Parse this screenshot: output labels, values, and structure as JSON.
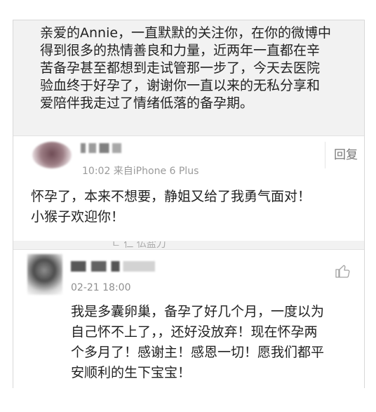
{
  "post": {
    "lines": [
      "亲爱的Annie，一直默默的关注你，在你的微博中",
      "得到很多的热情善良和力量，近两年一直都在辛",
      "苦备孕甚至都想到走试管那一步了，今天去医院",
      "验血终于好孕了，谢谢你一直以来的无私分享和",
      "爱陪伴我走过了情绪低落的备孕期。"
    ]
  },
  "comment1": {
    "meta": "10:02 来自iPhone 6 Plus",
    "reply_label": "回复",
    "lines": [
      "怀孕了，本来不想要，静姐又给了我勇气面对！",
      "小猴子欢迎你！"
    ]
  },
  "cut_strip_text": "ㄷ 仁 仏盐刀",
  "comment2": {
    "time": "02-21 18:00",
    "lines": [
      "我是多囊卵巢，备孕了好几个月，一度以为",
      "自己怀不上了，，还好没放弃！现在怀孕两",
      "个多月了！感谢主！感恩一切！愿我们都平",
      "安顺利的生下宝宝！"
    ]
  },
  "icons": {
    "like": "like-icon"
  }
}
